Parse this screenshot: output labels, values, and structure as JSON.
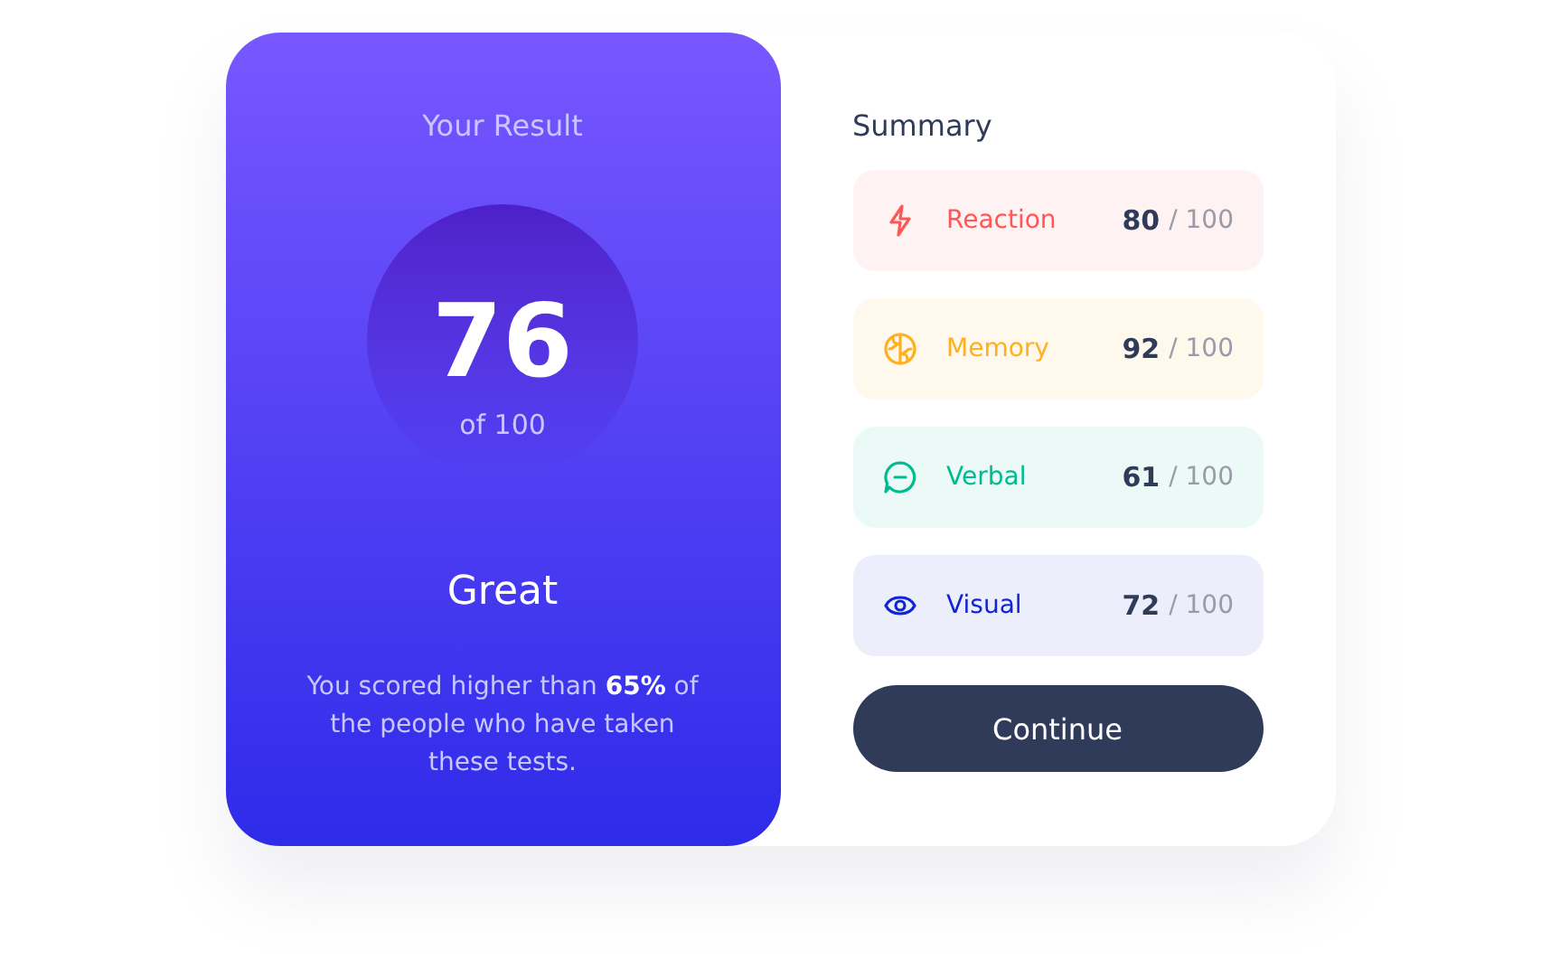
{
  "result": {
    "title": "Your Result",
    "score": "76",
    "out_of": "of 100",
    "rating": "Great",
    "description": "You scored higher than **65%** of the people who have taken these tests."
  },
  "summary": {
    "title": "Summary",
    "items": [
      {
        "kind": "reaction",
        "label": "Reaction",
        "score": "80",
        "max": "/ 100",
        "color": "#ff5757"
      },
      {
        "kind": "memory",
        "label": "Memory",
        "score": "92",
        "max": "/ 100",
        "color": "#ffb01f"
      },
      {
        "kind": "verbal",
        "label": "Verbal",
        "score": "61",
        "max": "/ 100",
        "color": "#00bb8f"
      },
      {
        "kind": "visual",
        "label": "Visual",
        "score": "72",
        "max": "/ 100",
        "color": "#1125d4"
      }
    ],
    "button": "Continue"
  }
}
